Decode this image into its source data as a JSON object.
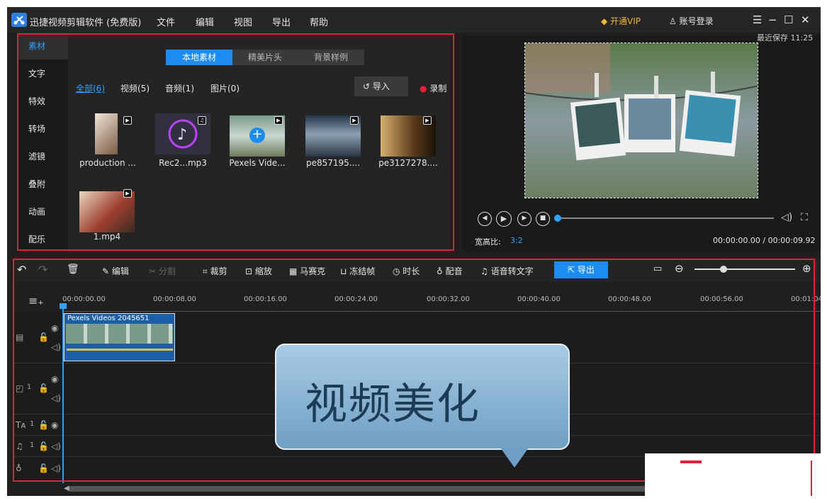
{
  "app": {
    "title": "迅捷视频剪辑软件 (免费版)"
  },
  "menu": [
    "文件",
    "编辑",
    "视图",
    "导出",
    "帮助"
  ],
  "header_right": {
    "vip": "开通VIP",
    "login": "账号登录"
  },
  "sidebar": {
    "items": [
      "素材",
      "文字",
      "特效",
      "转场",
      "滤镜",
      "叠附",
      "动画",
      "配乐"
    ],
    "active": "素材"
  },
  "media": {
    "tabs": [
      "本地素材",
      "精美片头",
      "背景样例"
    ],
    "filters": [
      "全部(6)",
      "视频(5)",
      "音频(1)",
      "图片(0)"
    ],
    "import_label": "导入",
    "record_label": "录制",
    "items": [
      {
        "name": "production ...",
        "kind": "video"
      },
      {
        "name": "Rec2...mp3",
        "kind": "audio"
      },
      {
        "name": "Pexels Vide...",
        "kind": "video"
      },
      {
        "name": "pe857195....",
        "kind": "video"
      },
      {
        "name": "pe3127278....",
        "kind": "video"
      },
      {
        "name": "1.mp4",
        "kind": "video"
      }
    ]
  },
  "preview": {
    "last_save": "最近保存 11:25",
    "ratio_label": "宽高比:",
    "ratio_value": "3:2",
    "timecode": "00:00:00.00 / 00:00:09.92",
    "progress": 0
  },
  "toolbar": {
    "edit": "编辑",
    "split": "分割",
    "crop": "裁剪",
    "zoom": "缩放",
    "mosaic": "马赛克",
    "freeze": "冻结帧",
    "duration": "时长",
    "dub": "配音",
    "speech": "语音转文字",
    "export": "导出"
  },
  "timeline": {
    "ticks": [
      "00:00:00.00",
      "00:00:08.00",
      "00:00:16.00",
      "00:00:24.00",
      "00:00:32.00",
      "00:00:40.00",
      "00:00:48.00",
      "00:00:56.00",
      "00:01:04"
    ],
    "clip_label": "Pexels Videos 2045651",
    "track_numbers": [
      "1",
      "1",
      "1"
    ]
  },
  "overlay": {
    "text": "视频美化"
  },
  "colors": {
    "accent": "#1d8cf0",
    "highlight": "#e0203a",
    "vip": "#f0b33a"
  }
}
